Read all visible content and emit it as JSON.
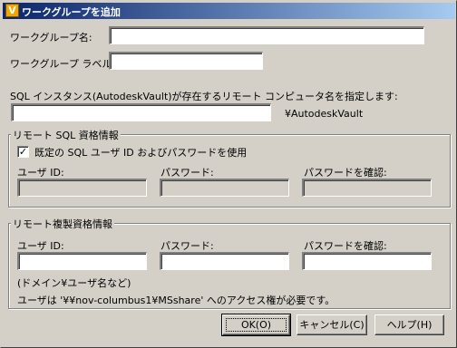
{
  "window": {
    "title": "ワークグループを追加",
    "icon": "vault-app-icon"
  },
  "fields": {
    "workgroup_name_label": "ワークグループ名:",
    "workgroup_name_value": "",
    "workgroup_label_label": "ワークグループ ラベル:",
    "workgroup_label_value": "",
    "sql_instance_label": "SQL インスタンス(AutodeskVault)が存在するリモート コンピュータ名を指定します:",
    "sql_instance_value": "",
    "sql_instance_suffix": "¥AutodeskVault"
  },
  "remote_sql": {
    "legend": "リモート SQL 資格情報",
    "checkbox_label": "既定の SQL ユーザ ID およびパスワードを使用",
    "checkbox_checked": true,
    "user_id_label": "ユーザ ID:",
    "password_label": "パスワード:",
    "confirm_label": "パスワードを確認:"
  },
  "remote_replication": {
    "legend": "リモート複製資格情報",
    "user_id_label": "ユーザ ID:",
    "password_label": "パスワード:",
    "confirm_label": "パスワードを確認:",
    "hint": "(ドメイン¥ユーザ名など)",
    "note": "ユーザは '¥¥nov-columbus1¥MSshare' へのアクセス権が必要です。"
  },
  "buttons": {
    "ok": "OK(O)",
    "cancel": "キャンセル(C)",
    "help": "ヘルプ(H)"
  }
}
